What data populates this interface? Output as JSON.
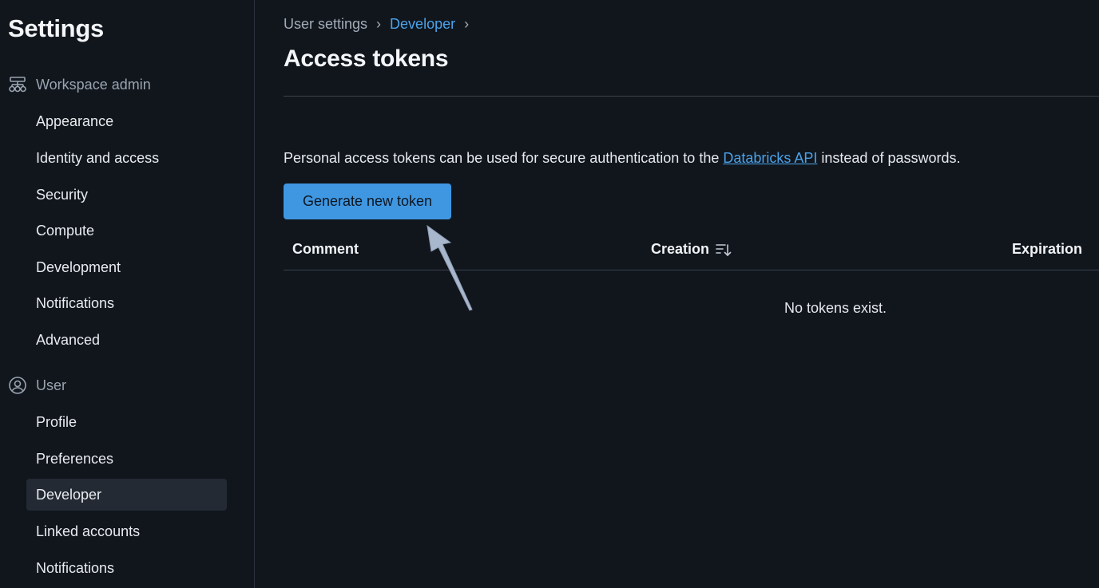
{
  "sidebar": {
    "title": "Settings",
    "workspace_section": {
      "label": "Workspace admin",
      "icon": "org-chart-icon",
      "items": [
        {
          "label": "Appearance"
        },
        {
          "label": "Identity and access"
        },
        {
          "label": "Security"
        },
        {
          "label": "Compute"
        },
        {
          "label": "Development"
        },
        {
          "label": "Notifications"
        },
        {
          "label": "Advanced"
        }
      ]
    },
    "user_section": {
      "label": "User",
      "icon": "user-circle-icon",
      "items": [
        {
          "label": "Profile"
        },
        {
          "label": "Preferences"
        },
        {
          "label": "Developer",
          "active": true
        },
        {
          "label": "Linked accounts"
        },
        {
          "label": "Notifications"
        }
      ]
    }
  },
  "breadcrumb": {
    "items": [
      "User settings",
      "Developer"
    ],
    "separator": "›"
  },
  "main": {
    "title": "Access tokens",
    "description_before": "Personal access tokens can be used for secure authentication to the ",
    "description_link": "Databricks API",
    "description_after": " instead of passwords.",
    "generate_button": "Generate new token",
    "table": {
      "columns": {
        "comment": "Comment",
        "creation": "Creation",
        "expiration": "Expiration"
      },
      "sort_icon": "sort-descending-icon",
      "empty_text": "No tokens exist."
    }
  },
  "colors": {
    "background": "#11161d",
    "accent": "#3f97e2",
    "link": "#4aa3ea",
    "annotation_arrow": "#a9b7cd"
  }
}
